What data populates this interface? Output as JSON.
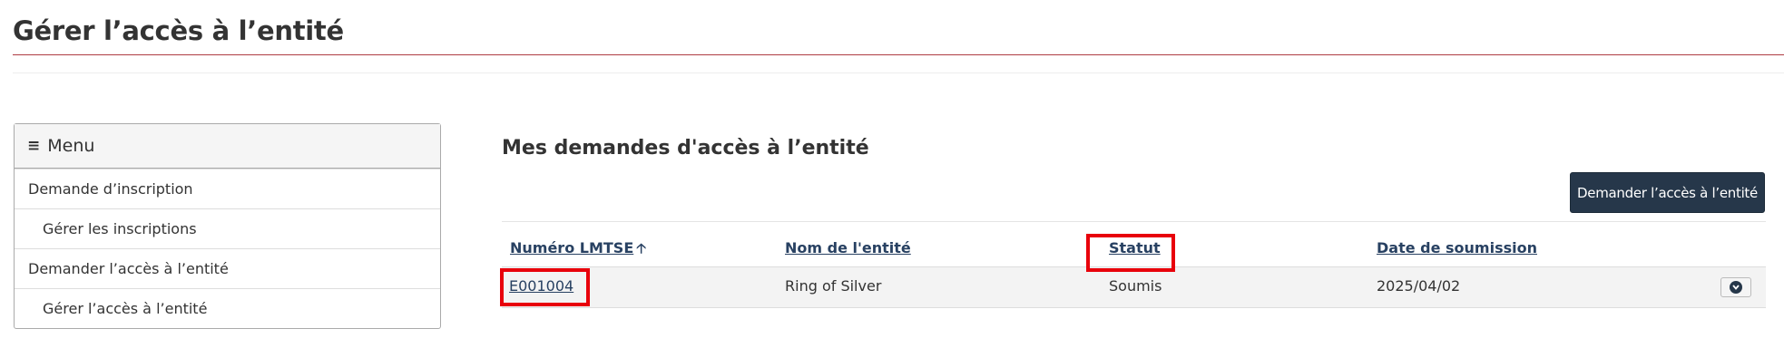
{
  "page": {
    "title": "Gérer l’accès à l’entité"
  },
  "menu": {
    "title": "Menu",
    "items": [
      {
        "label": "Demande d’inscription"
      },
      {
        "label": "Gérer les inscriptions"
      },
      {
        "label": "Demander l’accès à l’entité"
      },
      {
        "label": "Gérer l’accès à l’entité"
      }
    ]
  },
  "main": {
    "section_title": "Mes demandes d'accès à l’entité",
    "request_button": "Demander l’accès à l’entité",
    "table": {
      "columns": [
        "Numéro LMTSE",
        "Nom de l'entité",
        "Statut",
        "Date de soumission"
      ],
      "sort_column": "Numéro LMTSE",
      "rows": [
        {
          "id": "E001004",
          "name": "Ring of Silver",
          "status": "Soumis",
          "date": "2025/04/02"
        }
      ]
    }
  },
  "colors": {
    "accent_rule": "#af3c43",
    "button_bg": "#26374a",
    "link": "#284162",
    "highlight": "#e8000b"
  },
  "icons": {
    "menu": "hamburger-icon",
    "sort": "arrow-up-icon",
    "expand": "chevron-down-circle-icon"
  }
}
